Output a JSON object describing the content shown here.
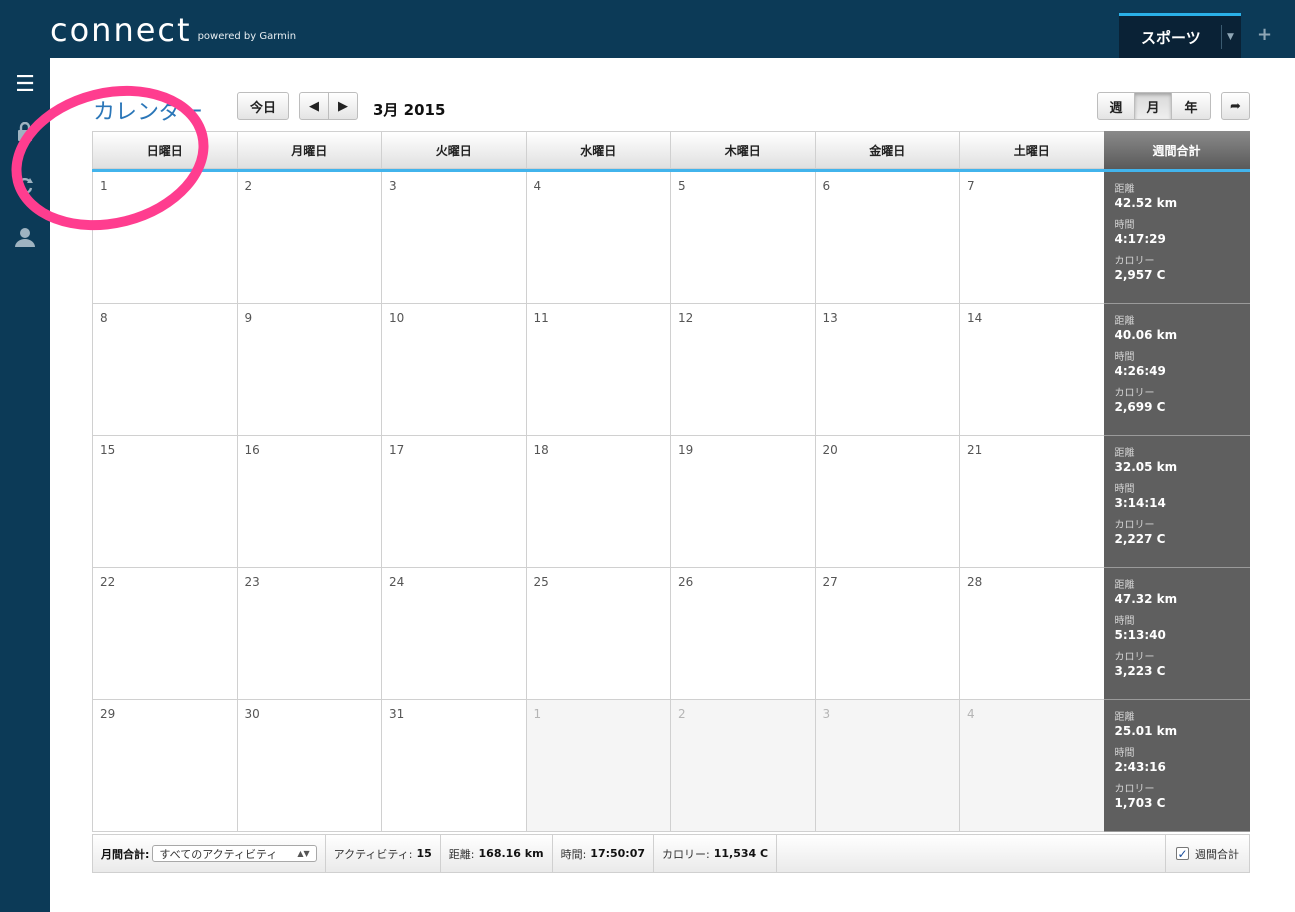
{
  "header": {
    "logo_main": "connect",
    "logo_sub": "powered by Garmin",
    "sports_tab": "スポーツ",
    "plus": "+"
  },
  "leftrail": {
    "menu_glyph": "☰",
    "icons": [
      "lock-icon",
      "sync-icon",
      "user-icon"
    ]
  },
  "toolbar": {
    "title": "カレンダー",
    "today": "今日",
    "prev": "◀",
    "next": "▶",
    "month_label": "3月 2015",
    "view_week": "週",
    "view_month": "月",
    "view_year": "年",
    "share": "➦"
  },
  "calendar": {
    "day_headers": [
      "日曜日",
      "月曜日",
      "火曜日",
      "水曜日",
      "木曜日",
      "金曜日",
      "土曜日"
    ],
    "total_header": "週間合計",
    "weeks": [
      {
        "days": [
          {
            "num": "1"
          },
          {
            "num": "2"
          },
          {
            "num": "3"
          },
          {
            "num": "4"
          },
          {
            "num": "5"
          },
          {
            "num": "6"
          },
          {
            "num": "7"
          }
        ],
        "totals": {
          "distance_label": "距離",
          "distance": "42.52 km",
          "time_label": "時間",
          "time": "4:17:29",
          "cal_label": "カロリー",
          "calories": "2,957 C"
        }
      },
      {
        "days": [
          {
            "num": "8"
          },
          {
            "num": "9"
          },
          {
            "num": "10"
          },
          {
            "num": "11"
          },
          {
            "num": "12"
          },
          {
            "num": "13"
          },
          {
            "num": "14"
          }
        ],
        "totals": {
          "distance_label": "距離",
          "distance": "40.06 km",
          "time_label": "時間",
          "time": "4:26:49",
          "cal_label": "カロリー",
          "calories": "2,699 C"
        }
      },
      {
        "days": [
          {
            "num": "15"
          },
          {
            "num": "16"
          },
          {
            "num": "17"
          },
          {
            "num": "18"
          },
          {
            "num": "19"
          },
          {
            "num": "20"
          },
          {
            "num": "21"
          }
        ],
        "totals": {
          "distance_label": "距離",
          "distance": "32.05 km",
          "time_label": "時間",
          "time": "3:14:14",
          "cal_label": "カロリー",
          "calories": "2,227 C"
        }
      },
      {
        "days": [
          {
            "num": "22"
          },
          {
            "num": "23"
          },
          {
            "num": "24"
          },
          {
            "num": "25"
          },
          {
            "num": "26"
          },
          {
            "num": "27"
          },
          {
            "num": "28"
          }
        ],
        "totals": {
          "distance_label": "距離",
          "distance": "47.32 km",
          "time_label": "時間",
          "time": "5:13:40",
          "cal_label": "カロリー",
          "calories": "3,223 C"
        }
      },
      {
        "days": [
          {
            "num": "29"
          },
          {
            "num": "30"
          },
          {
            "num": "31"
          },
          {
            "num": "1",
            "other": true
          },
          {
            "num": "2",
            "other": true
          },
          {
            "num": "3",
            "other": true
          },
          {
            "num": "4",
            "other": true
          }
        ],
        "totals": {
          "distance_label": "距離",
          "distance": "25.01 km",
          "time_label": "時間",
          "time": "2:43:16",
          "cal_label": "カロリー",
          "calories": "1,703 C"
        }
      }
    ]
  },
  "footer": {
    "monthly_label": "月間合計:",
    "activity_filter": "すべてのアクティビティ",
    "activities_label": "アクティビティ:",
    "activities_value": "15",
    "distance_label": "距離:",
    "distance_value": "168.16 km",
    "time_label": "時間:",
    "time_value": "17:50:07",
    "calories_label": "カロリー:",
    "calories_value": "11,534 C",
    "weekly_total_label": "週間合計",
    "weekly_total_checked": true
  },
  "colors": {
    "nav_bg": "#0c3a57",
    "accent_blue": "#2ab0e8",
    "title_blue": "#2a76b8",
    "totals_bg": "#5f5f5f",
    "annotation": "#ff3d8f"
  }
}
